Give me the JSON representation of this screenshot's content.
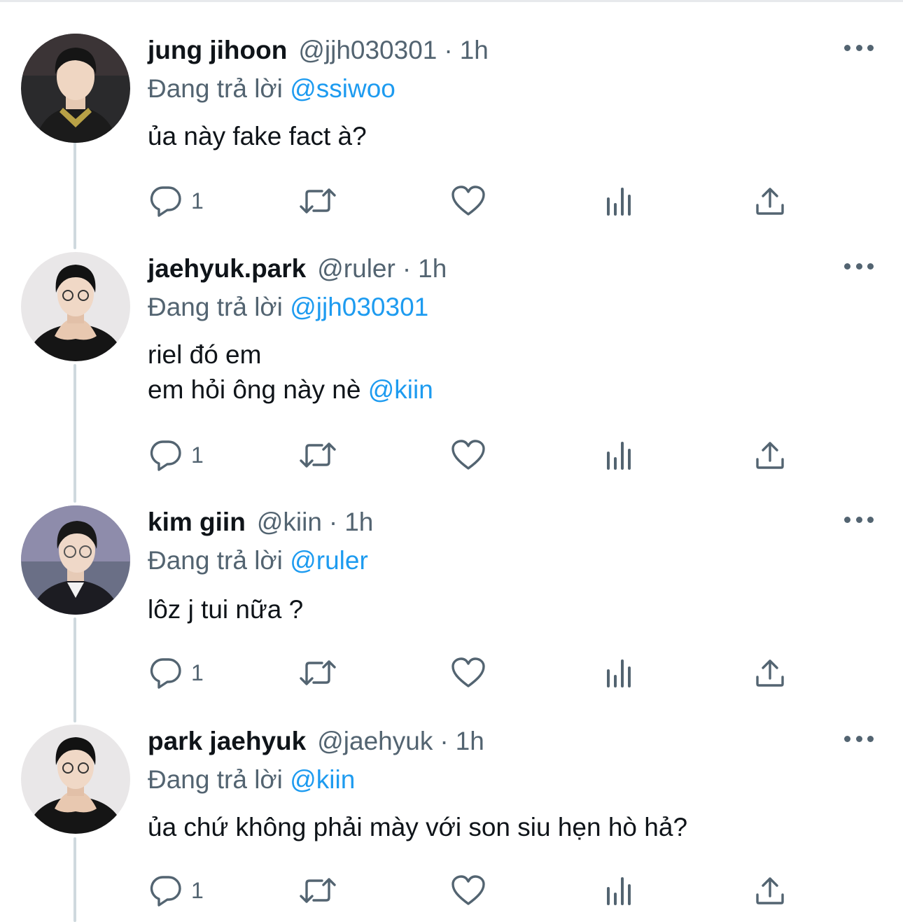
{
  "ui": {
    "colors": {
      "text": "#0f1419",
      "secondary": "#536471",
      "link": "#1d9bf0",
      "thread_line": "#cfd9de",
      "background": "#ffffff"
    },
    "icons": [
      "reply-icon",
      "retweet-icon",
      "like-icon",
      "analytics-icon",
      "share-icon",
      "more-options-icon"
    ]
  },
  "tweets": [
    {
      "name": "jung jihoon",
      "handle": "@jjh030301",
      "separator": "·",
      "time": "1h",
      "reply_prefix": "Đang trả lời",
      "reply_to": "@ssiwoo",
      "lines": [
        "ủa này fake fact à?"
      ],
      "mention_suffix": "",
      "reply_count": "1"
    },
    {
      "name": "jaehyuk.park",
      "handle": "@ruler",
      "separator": "·",
      "time": "1h",
      "reply_prefix": "Đang trả lời",
      "reply_to": "@jjh030301",
      "lines": [
        "riel đó em",
        "em hỏi ông này nè"
      ],
      "mention_suffix": "@kiin",
      "reply_count": "1"
    },
    {
      "name": "kim giin",
      "handle": "@kiin",
      "separator": "·",
      "time": "1h",
      "reply_prefix": "Đang trả lời",
      "reply_to": "@ruler",
      "lines": [
        "lôz j tui nữa ?"
      ],
      "mention_suffix": "",
      "reply_count": "1"
    },
    {
      "name": "park jaehyuk",
      "handle": "@jaehyuk",
      "separator": "·",
      "time": "1h",
      "reply_prefix": "Đang trả lời",
      "reply_to": "@kiin",
      "lines": [
        "ủa chứ không phải mày với son siu hẹn hò hả?"
      ],
      "mention_suffix": "",
      "reply_count": "1"
    }
  ]
}
